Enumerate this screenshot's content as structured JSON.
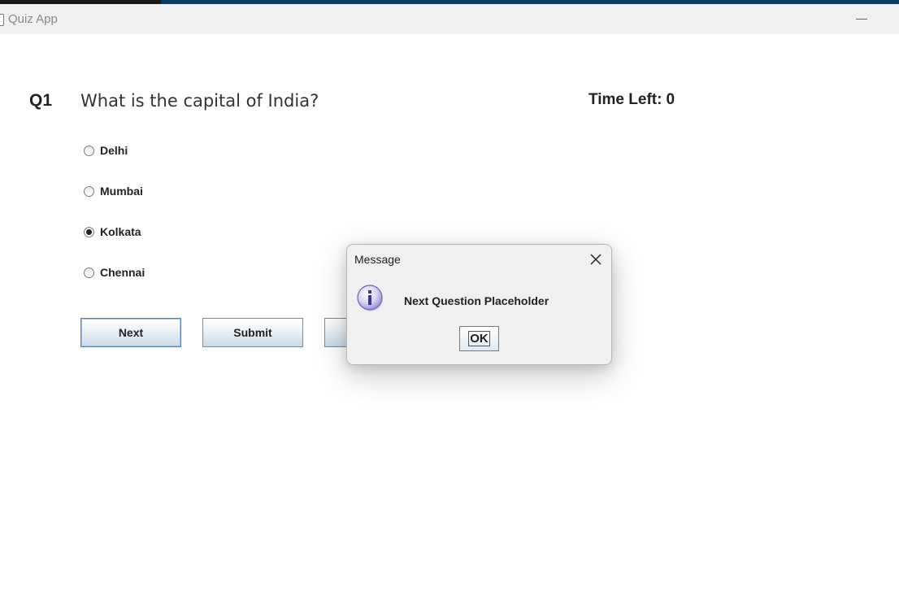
{
  "window": {
    "title": "Quiz App",
    "minimize_glyph": "—"
  },
  "question": {
    "number": "Q1",
    "text": "What is the capital of India?"
  },
  "timer": {
    "label": "Time Left:",
    "value": "0"
  },
  "options": [
    {
      "label": "Delhi",
      "selected": false
    },
    {
      "label": "Mumbai",
      "selected": false
    },
    {
      "label": "Kolkata",
      "selected": true
    },
    {
      "label": "Chennai",
      "selected": false
    }
  ],
  "buttons": {
    "next": "Next",
    "submit": "Submit"
  },
  "dialog": {
    "title": "Message",
    "message": "Next Question Placeholder",
    "ok": "OK",
    "icon": "info-icon"
  },
  "colors": {
    "accent": "#5b80a8",
    "taskbar": "#0b3c5d"
  }
}
